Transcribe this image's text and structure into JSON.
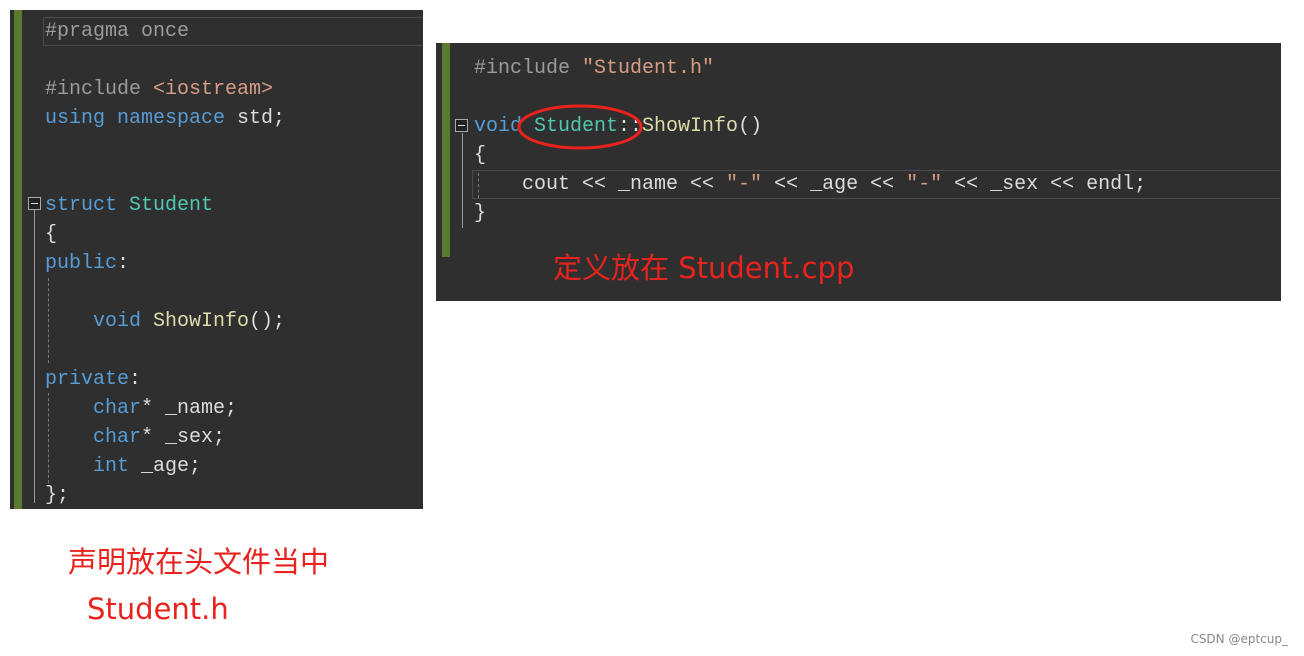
{
  "header_file": {
    "lines": [
      [
        {
          "t": "#pragma once",
          "c": "pp"
        }
      ],
      [],
      [
        {
          "t": "#include ",
          "c": "pp"
        },
        {
          "t": "<iostream>",
          "c": "st"
        }
      ],
      [
        {
          "t": "using ",
          "c": "kw"
        },
        {
          "t": "namespace ",
          "c": "kw"
        },
        {
          "t": "std;",
          "c": "df"
        }
      ],
      [],
      [],
      [
        {
          "t": "struct ",
          "c": "kw"
        },
        {
          "t": "Student",
          "c": "ty"
        }
      ],
      [
        {
          "t": "{",
          "c": "df"
        }
      ],
      [
        {
          "t": "public",
          "c": "kw"
        },
        {
          "t": ":",
          "c": "df"
        }
      ],
      [],
      [
        {
          "t": "    void ",
          "c": "kw"
        },
        {
          "t": "ShowInfo",
          "c": "fn"
        },
        {
          "t": "();",
          "c": "df"
        }
      ],
      [],
      [
        {
          "t": "private",
          "c": "kw"
        },
        {
          "t": ":",
          "c": "df"
        }
      ],
      [
        {
          "t": "    char",
          "c": "kw"
        },
        {
          "t": "* _name;",
          "c": "df"
        }
      ],
      [
        {
          "t": "    char",
          "c": "kw"
        },
        {
          "t": "* _sex;",
          "c": "df"
        }
      ],
      [
        {
          "t": "    int",
          "c": "kw"
        },
        {
          "t": " _age;",
          "c": "df"
        }
      ],
      [
        {
          "t": "};",
          "c": "df"
        }
      ]
    ],
    "caption_line1": "声明放在头文件当中",
    "caption_line2": "Student.h"
  },
  "source_file": {
    "lines": [
      [
        {
          "t": "#include ",
          "c": "pp"
        },
        {
          "t": "\"Student.h\"",
          "c": "st"
        }
      ],
      [],
      [
        {
          "t": "void ",
          "c": "kw"
        },
        {
          "t": "Student",
          "c": "ty"
        },
        {
          "t": "::",
          "c": "df"
        },
        {
          "t": "ShowInfo",
          "c": "fn"
        },
        {
          "t": "()",
          "c": "df"
        }
      ],
      [
        {
          "t": "{",
          "c": "df"
        }
      ],
      [
        {
          "t": "    cout << _name << ",
          "c": "df"
        },
        {
          "t": "\"-\"",
          "c": "st"
        },
        {
          "t": " << _age << ",
          "c": "df"
        },
        {
          "t": "\"-\"",
          "c": "st"
        },
        {
          "t": " << _sex << endl;",
          "c": "df"
        }
      ],
      [
        {
          "t": "}",
          "c": "df"
        }
      ]
    ],
    "caption": "定义放在 Student.cpp",
    "highlight_color": "#e8231e"
  },
  "watermark": "CSDN @eptcup_"
}
